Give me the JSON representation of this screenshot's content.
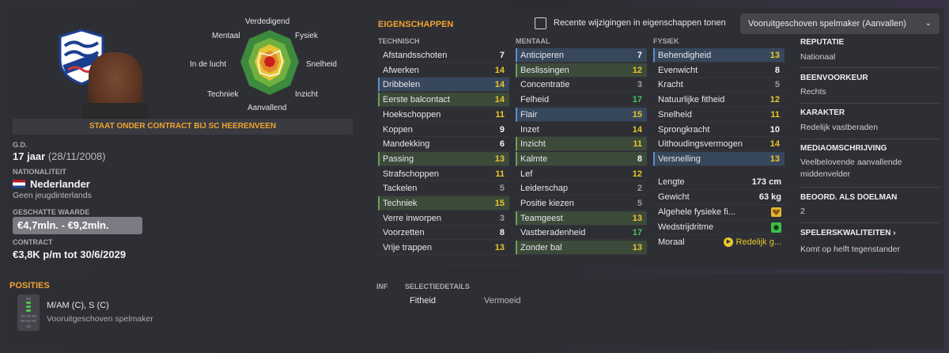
{
  "player": {
    "contract_banner": "STAAT ONDER CONTRACT BIJ SC HEERENVEEN",
    "dob_label": "G.D.",
    "age": "17 jaar",
    "dob": "(28/11/2008)",
    "nationality_label": "NATIONALITEIT",
    "nationality": "Nederlander",
    "intl_caps": "Geen jeugdinterlands",
    "value_label": "GESCHATTE WAARDE",
    "value": "€4,7mln. - €9,2mln.",
    "contract_label": "CONTRACT",
    "contract": "€3,8K p/m tot 30/6/2029"
  },
  "radar": {
    "labels": [
      "Verdedigend",
      "Fysiek",
      "Snelheid",
      "Inzicht",
      "Aanvallend",
      "Techniek",
      "In de lucht",
      "Mentaal"
    ]
  },
  "attributes": {
    "title": "EIGENSCHAPPEN",
    "checkbox_label": "Recente wijzigingen in eigenschappen tonen",
    "role": "Vooruitgeschoven spelmaker (Aanvallen)",
    "technical_header": "TECHNISCH",
    "mental_header": "MENTAAL",
    "physical_header": "FYSIEK",
    "technical": [
      {
        "name": "Afstandsschoten",
        "value": "7",
        "color": "white",
        "hl": ""
      },
      {
        "name": "Afwerken",
        "value": "14",
        "color": "yellow",
        "hl": ""
      },
      {
        "name": "Dribbelen",
        "value": "14",
        "color": "yellow",
        "hl": "blue"
      },
      {
        "name": "Eerste balcontact",
        "value": "14",
        "color": "yellow",
        "hl": "green"
      },
      {
        "name": "Hoekschoppen",
        "value": "11",
        "color": "yellow",
        "hl": ""
      },
      {
        "name": "Koppen",
        "value": "9",
        "color": "white",
        "hl": ""
      },
      {
        "name": "Mandekking",
        "value": "6",
        "color": "white",
        "hl": ""
      },
      {
        "name": "Passing",
        "value": "13",
        "color": "yellow",
        "hl": "green"
      },
      {
        "name": "Strafschoppen",
        "value": "11",
        "color": "yellow",
        "hl": ""
      },
      {
        "name": "Tackelen",
        "value": "5",
        "color": "gray",
        "hl": ""
      },
      {
        "name": "Techniek",
        "value": "15",
        "color": "yellow",
        "hl": "green"
      },
      {
        "name": "Verre inworpen",
        "value": "3",
        "color": "gray",
        "hl": ""
      },
      {
        "name": "Voorzetten",
        "value": "8",
        "color": "white",
        "hl": ""
      },
      {
        "name": "Vrije trappen",
        "value": "13",
        "color": "yellow",
        "hl": ""
      }
    ],
    "mental": [
      {
        "name": "Anticiperen",
        "value": "7",
        "color": "white",
        "hl": "blue"
      },
      {
        "name": "Beslissingen",
        "value": "12",
        "color": "yellow",
        "hl": "green"
      },
      {
        "name": "Concentratie",
        "value": "3",
        "color": "gray",
        "hl": ""
      },
      {
        "name": "Felheid",
        "value": "17",
        "color": "green",
        "hl": ""
      },
      {
        "name": "Flair",
        "value": "15",
        "color": "yellow",
        "hl": "blue"
      },
      {
        "name": "Inzet",
        "value": "14",
        "color": "yellow",
        "hl": ""
      },
      {
        "name": "Inzicht",
        "value": "11",
        "color": "yellow",
        "hl": "green"
      },
      {
        "name": "Kalmte",
        "value": "8",
        "color": "white",
        "hl": "green"
      },
      {
        "name": "Lef",
        "value": "12",
        "color": "yellow",
        "hl": ""
      },
      {
        "name": "Leiderschap",
        "value": "2",
        "color": "gray",
        "hl": ""
      },
      {
        "name": "Positie kiezen",
        "value": "5",
        "color": "gray",
        "hl": ""
      },
      {
        "name": "Teamgeest",
        "value": "13",
        "color": "yellow",
        "hl": "green"
      },
      {
        "name": "Vastberadenheid",
        "value": "17",
        "color": "green",
        "hl": ""
      },
      {
        "name": "Zonder bal",
        "value": "13",
        "color": "yellow",
        "hl": "green"
      }
    ],
    "physical": [
      {
        "name": "Behendigheid",
        "value": "13",
        "color": "yellow",
        "hl": "blue"
      },
      {
        "name": "Evenwicht",
        "value": "8",
        "color": "white",
        "hl": ""
      },
      {
        "name": "Kracht",
        "value": "5",
        "color": "gray",
        "hl": ""
      },
      {
        "name": "Natuurlijke fitheid",
        "value": "12",
        "color": "yellow",
        "hl": ""
      },
      {
        "name": "Snelheid",
        "value": "11",
        "color": "yellow",
        "hl": ""
      },
      {
        "name": "Sprongkracht",
        "value": "10",
        "color": "white",
        "hl": ""
      },
      {
        "name": "Uithoudingsvermogen",
        "value": "14",
        "color": "yellow",
        "hl": ""
      },
      {
        "name": "Versnelling",
        "value": "13",
        "color": "yellow",
        "hl": "blue"
      }
    ],
    "stats": {
      "length_label": "Lengte",
      "length": "173 cm",
      "weight_label": "Gewicht",
      "weight": "63 kg",
      "fitness_label": "Algehele fysieke fi...",
      "sharpness_label": "Wedstrijdritme",
      "morale_label": "Moraal",
      "morale": "Redelijk g..."
    }
  },
  "side": {
    "reputation_label": "REPUTATIE",
    "reputation": "Nationaal",
    "foot_label": "BEENVOORKEUR",
    "foot": "Rechts",
    "character_label": "KARAKTER",
    "character": "Redelijk vastberaden",
    "media_label": "MEDIAOMSCHRIJVING",
    "media": "Veelbelovende aanvallende middenvelder",
    "gk_label": "BEOORD. ALS DOELMAN",
    "gk": "2",
    "qualities_label": "SPELERSKWALITEITEN",
    "qualities": "Komt op helft tegenstander"
  },
  "positions": {
    "title": "POSITIES",
    "main": "M/AM (C), S (C)",
    "role": "Vooruitgeschoven spelmaker"
  },
  "selection": {
    "col1": "INF",
    "col2": "SELECTIEDETAILS",
    "row_label": "Fitheid",
    "row_value": "Vermoeid"
  },
  "colors": {
    "accent": "#f0a330",
    "yellow": "#e8c72c",
    "green": "#48c45c",
    "highlight_blue": "#37475c",
    "highlight_green": "#3c4a3a"
  }
}
